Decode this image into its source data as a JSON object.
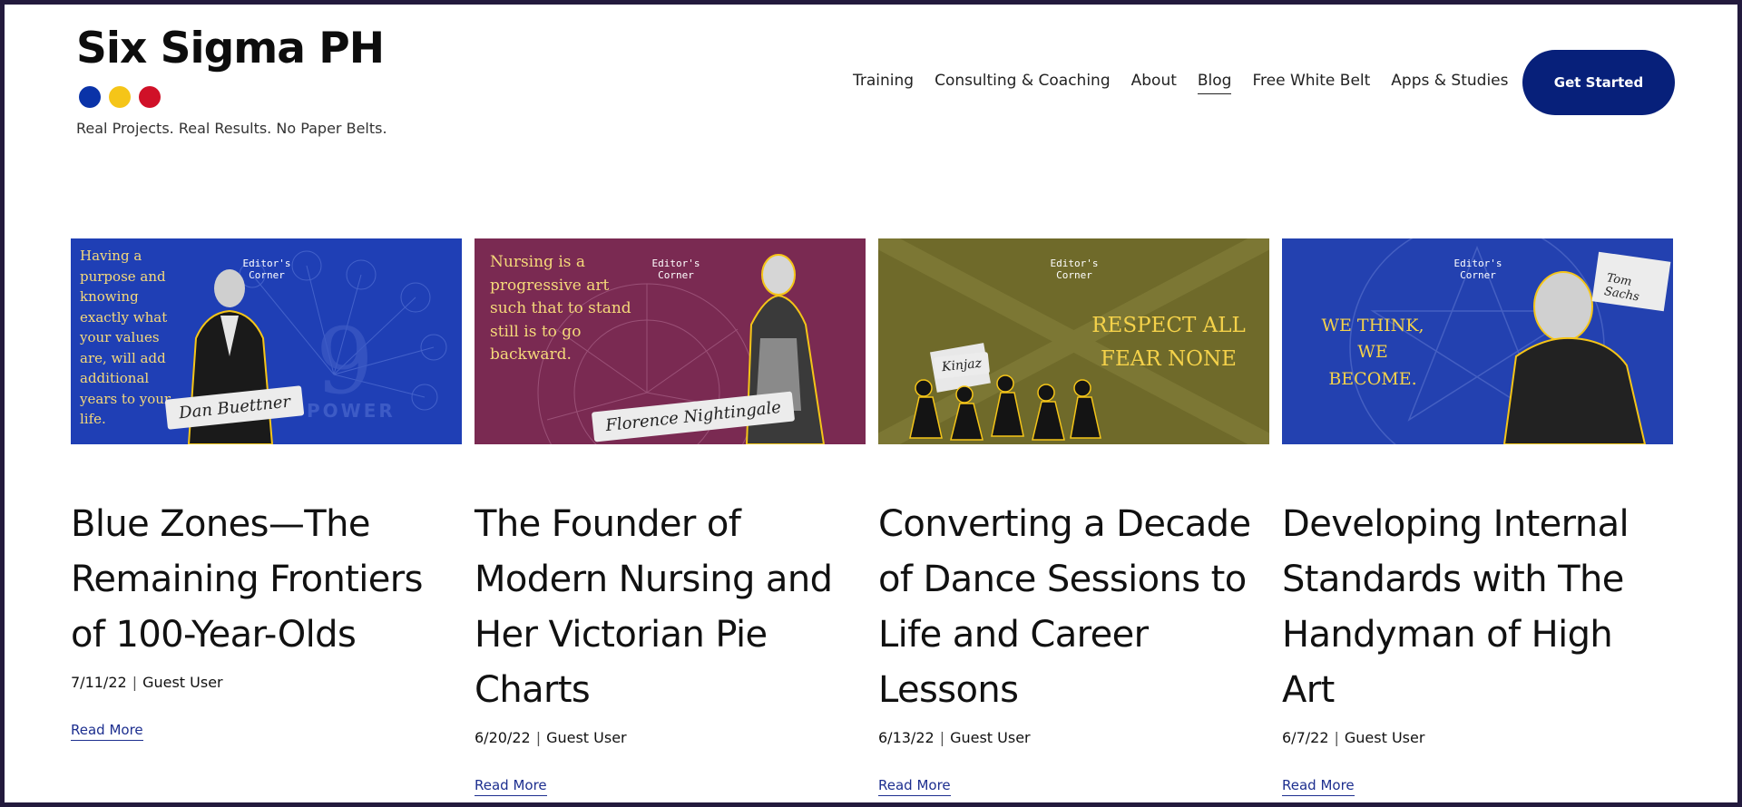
{
  "brand": {
    "title": "Six Sigma PH",
    "tagline": "Real Projects. Real Results. No Paper Belts.",
    "dot_colors": [
      "#0a33a8",
      "#f5c518",
      "#d01128"
    ]
  },
  "nav": {
    "items": [
      "Training",
      "Consulting & Coaching",
      "About",
      "Blog",
      "Free White Belt",
      "Apps & Studies"
    ],
    "active": "Blog"
  },
  "cta": {
    "label": "Get Started",
    "color": "#07207a"
  },
  "posts": [
    {
      "title": "Blue Zones—The Remaining Frontiers of 100-Year-Olds",
      "date": "7/11/22",
      "author": "Guest User",
      "read_more": "Read More",
      "thumb": {
        "bg": "#1f3fb5",
        "quote": "Having a purpose and knowing exactly what your values are, will add additional years to your life.",
        "quote_color": "#f5d97a",
        "badge": "Editor's Corner",
        "signature": "Dan Buettner",
        "big_text": "9",
        "sub_text": "POWER"
      }
    },
    {
      "title": "The Founder of Modern Nursing and Her Victorian Pie Charts",
      "date": "6/20/22",
      "author": "Guest User",
      "read_more": "Read More",
      "thumb": {
        "bg": "#7a2a52",
        "quote": "Nursing is a progressive art such that to stand still is to go backward.",
        "quote_color": "#f5d97a",
        "badge": "Editor's Corner",
        "signature": "Florence Nightingale"
      }
    },
    {
      "title": "Converting a Decade of Dance Sessions to Life and Career Lessons",
      "date": "6/13/22",
      "author": "Guest User",
      "read_more": "Read More",
      "thumb": {
        "bg": "#6f6a2a",
        "quote": "RESPECT ALL FEAR NONE",
        "quote_color": "#f5d24a",
        "badge": "Editor's Corner",
        "signature": "Kinjaz"
      }
    },
    {
      "title": "Developing Internal Standards with The Handyman of High Art",
      "date": "6/7/22",
      "author": "Guest User",
      "read_more": "Read More",
      "thumb": {
        "bg": "#2341b0",
        "quote": "WE THINK, WE BECOME.",
        "quote_color": "#f5d24a",
        "badge": "Editor's Corner",
        "signature": "Tom Sachs"
      }
    }
  ]
}
